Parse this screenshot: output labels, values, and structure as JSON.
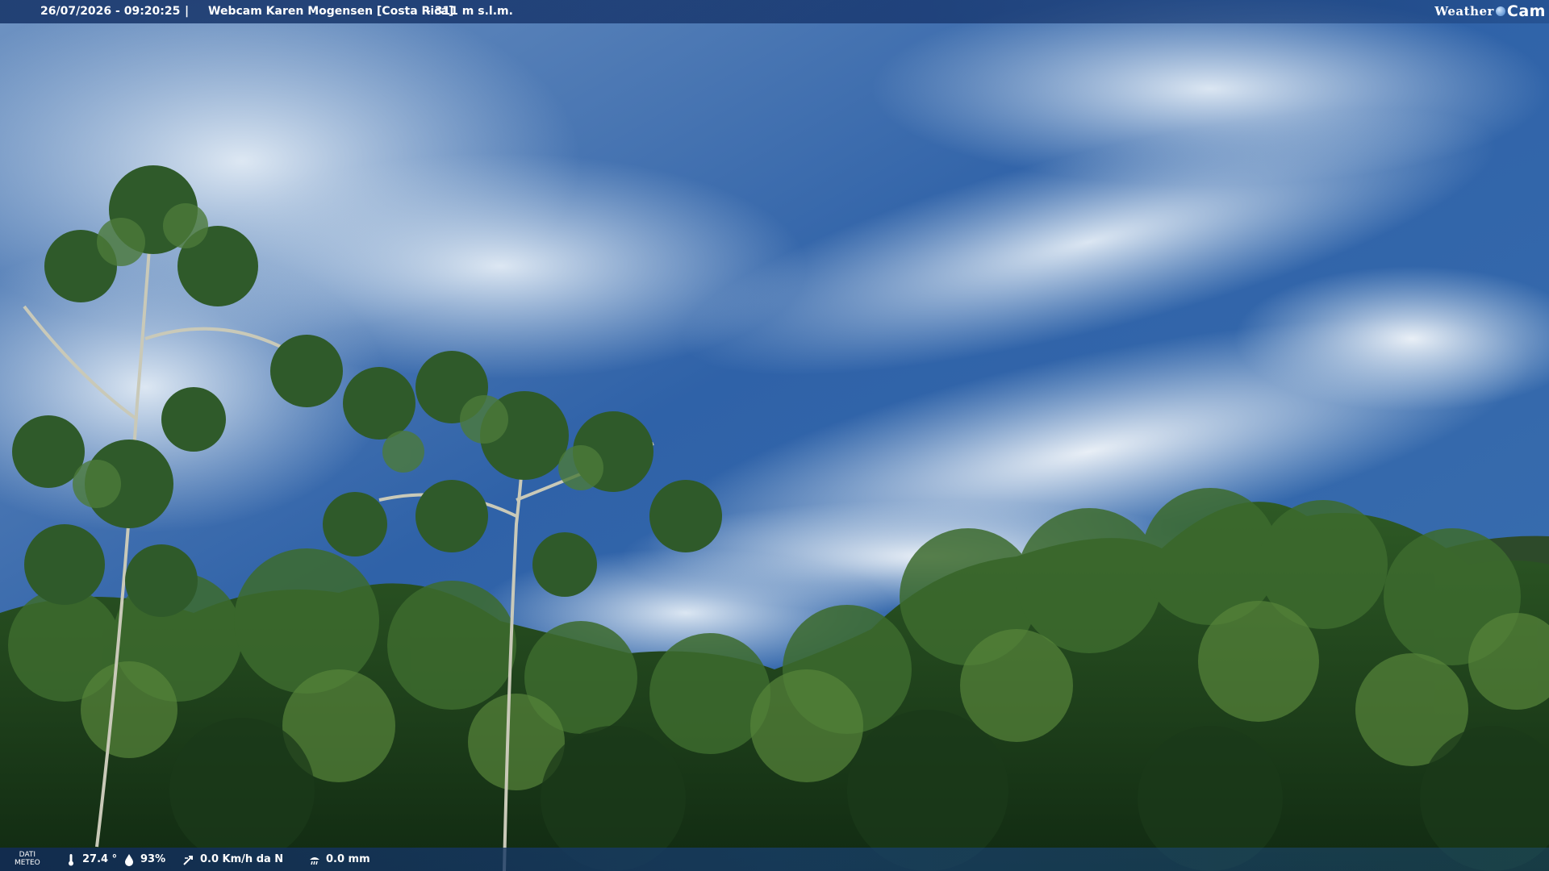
{
  "header": {
    "datetime": "26/07/2026 - 09:20:25",
    "separator": "|",
    "title": "Webcam Karen Mogensen [Costa Rica]",
    "altitude": "- 311 m s.l.m.",
    "brand_weather": "Weather",
    "brand_cam": "Cam"
  },
  "footer": {
    "dati_line1": "DATI",
    "dati_line2": "METEO",
    "temperature": "27.4 °",
    "humidity": "93%",
    "wind": "0.0 Km/h da N",
    "rain": "0.0 mm",
    "icons": [
      "thermometer-icon",
      "humidity-drop-icon",
      "wind-vane-icon",
      "rain-gauge-icon"
    ]
  },
  "colors": {
    "sky_top": "#2f62a8",
    "sky_bottom": "#8fb3d8",
    "cloud": "#d9e6f2",
    "foliage_dark": "#1b3a1a",
    "foliage_mid": "#2f5b26",
    "foliage_light": "#5d8a3c"
  }
}
